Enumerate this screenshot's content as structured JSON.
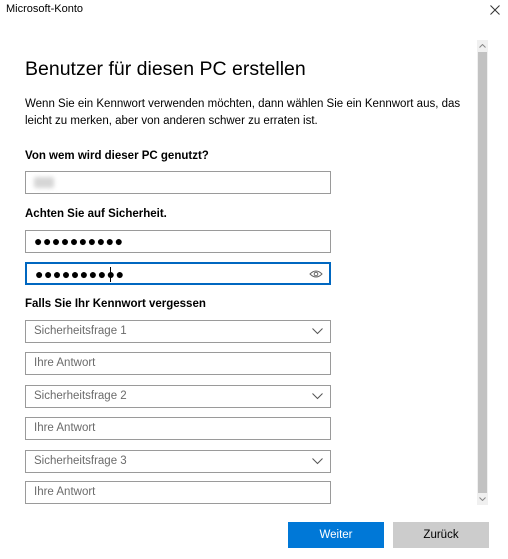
{
  "window": {
    "title": "Microsoft-Konto"
  },
  "page": {
    "heading": "Benutzer für diesen PC erstellen",
    "intro": "Wenn Sie ein Kennwort verwenden möchten, dann wählen Sie ein Kennwort aus, das leicht zu merken, aber von anderen schwer zu erraten ist."
  },
  "user_section": {
    "label": "Von wem wird dieser PC genutzt?"
  },
  "security_section": {
    "label": "Achten Sie auf Sicherheit.",
    "password_mask": "●●●●●●●●●●",
    "confirm_mask": "●●●●●●●●●●"
  },
  "recovery_section": {
    "label": "Falls Sie Ihr Kennwort vergessen",
    "question1": "Sicherheitsfrage 1",
    "answer1_placeholder": "Ihre Antwort",
    "question2": "Sicherheitsfrage 2",
    "answer2_placeholder": "Ihre Antwort",
    "question3": "Sicherheitsfrage 3",
    "answer3_placeholder": "Ihre Antwort"
  },
  "buttons": {
    "next": "Weiter",
    "back": "Zurück"
  },
  "colors": {
    "accent": "#0078d7",
    "focus_border": "#0067c0",
    "secondary_button": "#cccccc",
    "scrollbar_thumb": "#c2c2c2"
  },
  "icons": {
    "close": "close-icon",
    "chevron": "chevron-down-icon",
    "reveal": "eye-icon"
  }
}
